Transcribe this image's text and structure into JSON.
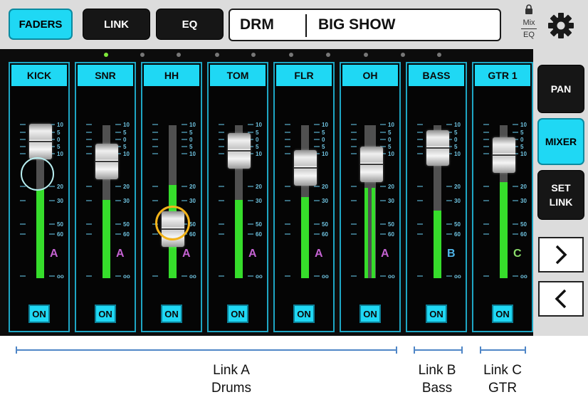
{
  "top_tabs": [
    {
      "label": "FADERS",
      "active": true
    },
    {
      "label": "LINK",
      "active": false
    },
    {
      "label": "EQ",
      "active": false
    }
  ],
  "group_name": "DRM",
  "show_name": "BIG SHOW",
  "mix_eq": {
    "top": "Mix",
    "bottom": "EQ",
    "icon": "lock-icon"
  },
  "settings_icon": "gear-icon",
  "scale_top_labels": [
    "10",
    "5",
    "0",
    "5",
    "10"
  ],
  "scale_bottom_labels": [
    "20",
    "30",
    "50",
    "60",
    "oo"
  ],
  "channels": [
    {
      "name": "KICK",
      "link": "A",
      "link_color": "#c462d1",
      "on_label": "ON",
      "fader_level": 0.93,
      "meter_level": 0.58
    },
    {
      "name": "SNR",
      "link": "A",
      "link_color": "#c462d1",
      "on_label": "ON",
      "fader_level": 0.8,
      "meter_level": 0.51
    },
    {
      "name": "HH",
      "link": "A",
      "link_color": "#c462d1",
      "on_label": "ON",
      "fader_level": 0.36,
      "meter_level": 0.61
    },
    {
      "name": "TOM",
      "link": "A",
      "link_color": "#c462d1",
      "on_label": "ON",
      "fader_level": 0.87,
      "meter_level": 0.51
    },
    {
      "name": "FLR",
      "link": "A",
      "link_color": "#c462d1",
      "on_label": "ON",
      "fader_level": 0.76,
      "meter_level": 0.53
    },
    {
      "name": "OH",
      "link": "A",
      "link_color": "#c462d1",
      "on_label": "ON",
      "fader_level": 0.78,
      "meter_level": 0.59
    },
    {
      "name": "BASS",
      "link": "B",
      "link_color": "#4fb4e8",
      "on_label": "ON",
      "fader_level": 0.89,
      "meter_level": 0.44
    },
    {
      "name": "GTR 1",
      "link": "C",
      "link_color": "#8bdc6a",
      "on_label": "ON",
      "fader_level": 0.84,
      "meter_level": 0.63
    }
  ],
  "side_buttons": [
    {
      "label": "PAN",
      "active": false
    },
    {
      "label": "MIXER",
      "active": true
    },
    {
      "label": "SET LINK",
      "active": false
    }
  ],
  "nav": {
    "next_icon": "chevron-right-icon",
    "prev_icon": "chevron-left-icon"
  },
  "link_groups": [
    {
      "line1": "Link A",
      "line2": "Drums"
    },
    {
      "line1": "Link B",
      "line2": "Bass"
    },
    {
      "line1": "Link C",
      "line2": "GTR"
    }
  ],
  "highlight_colors": {
    "cyan_ring": "#b8eef0",
    "orange_ring": "#f2b31a",
    "bracket": "#4f86c7"
  }
}
